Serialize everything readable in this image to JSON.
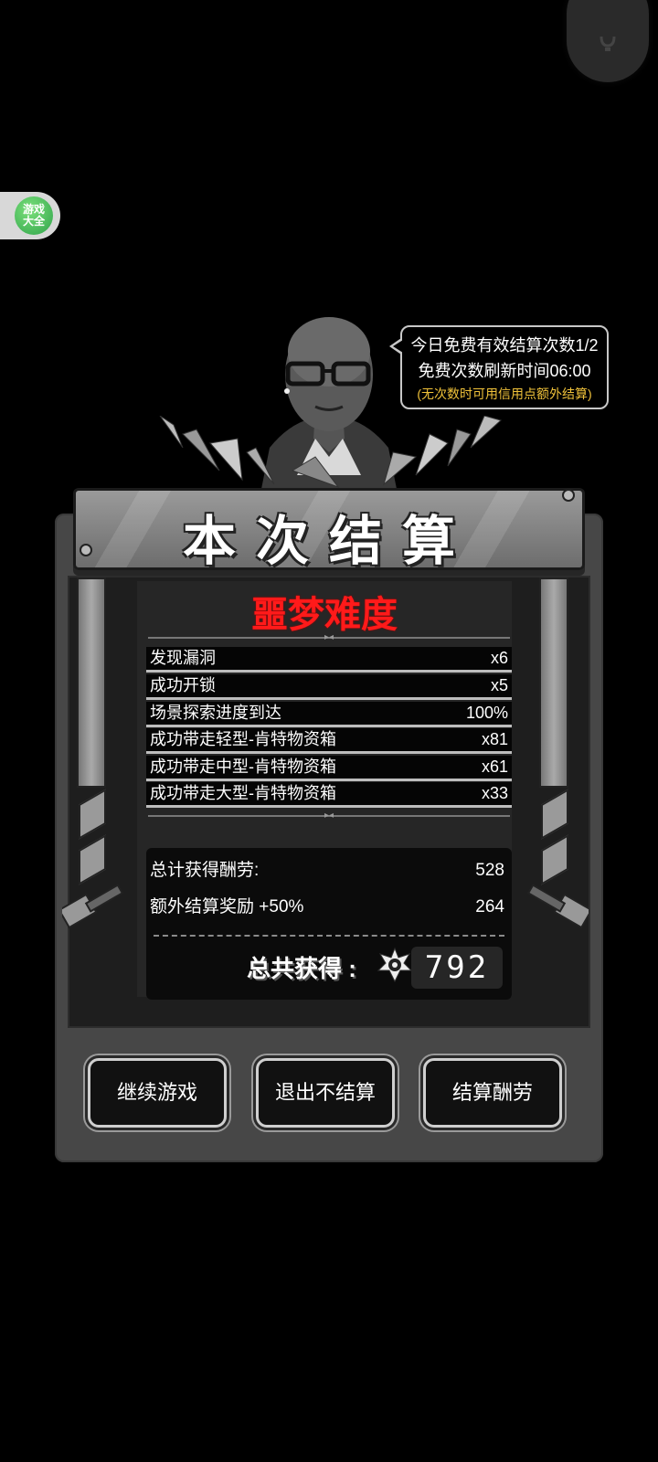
{
  "colors": {
    "background": "#000000",
    "panel": "#474747",
    "difficulty": "#ff1a1a",
    "notice_highlight": "#f0c23a"
  },
  "corner_button": {
    "icon": "lightbulb-icon"
  },
  "game_center_badge": {
    "line1": "游戏",
    "line2": "大全"
  },
  "notice": {
    "line1": "今日免费有效结算次数1/2",
    "line2": "免费次数刷新时间06:00",
    "line3": "(无次数时可用信用点额外结算)"
  },
  "panel": {
    "title": "本次结算",
    "difficulty": "噩梦难度",
    "stats": [
      {
        "label": "发现漏洞",
        "value": "x6"
      },
      {
        "label": "成功开锁",
        "value": "x5"
      },
      {
        "label": "场景探索进度到达",
        "value": "100%"
      },
      {
        "label": "成功带走轻型-肯特物资箱",
        "value": "x81"
      },
      {
        "label": "成功带走中型-肯特物资箱",
        "value": "x61"
      },
      {
        "label": "成功带走大型-肯特物资箱",
        "value": "x33"
      }
    ],
    "summary": {
      "total_reward_label": "总计获得酬劳:",
      "total_reward_value": "528",
      "bonus_label": "额外结算奖励 +50%",
      "bonus_value": "264",
      "grand_total_label": "总共获得",
      "grand_total_value": "792"
    }
  },
  "buttons": {
    "continue": "继续游戏",
    "exit": "退出不结算",
    "settle": "结算酬劳"
  }
}
